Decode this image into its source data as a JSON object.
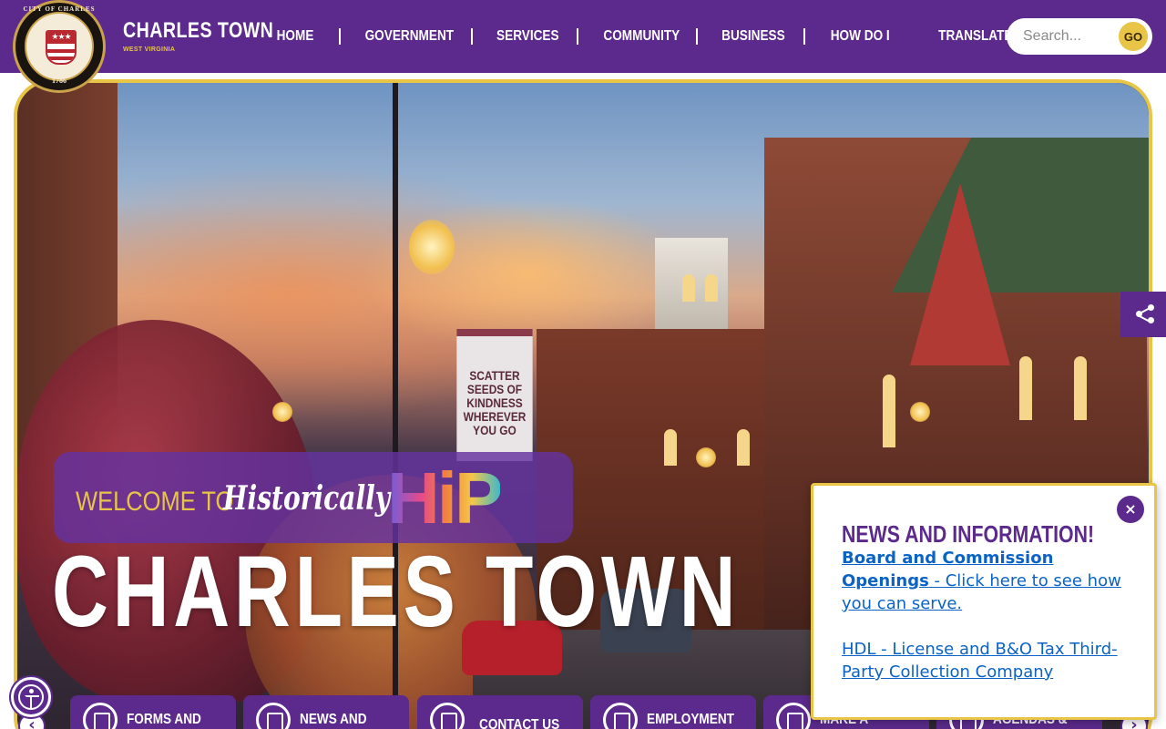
{
  "brand": {
    "title": "CHARLES TOWN",
    "subtitle": "WEST VIRGINIA",
    "seal_ring_text": "CITY OF CHARLES TOWN",
    "seal_year": "1786",
    "seal_stars": "★★★"
  },
  "nav": {
    "items": [
      "HOME",
      "GOVERNMENT",
      "SERVICES",
      "COMMUNITY",
      "BUSINESS",
      "HOW DO I",
      "TRANSLATE"
    ]
  },
  "search": {
    "placeholder": "Search...",
    "go_label": "GO"
  },
  "hero": {
    "welcome_to": "WELCOME TO",
    "welcome_script": "Historically",
    "welcome_hip": "HiP",
    "title": "CHARLES TOWN",
    "banner_text": "SCATTER SEEDS OF KINDNESS WHEREVER YOU GO"
  },
  "quick_links": [
    {
      "label": "FORMS AND"
    },
    {
      "label": "NEWS AND"
    },
    {
      "label": "CONTACT US"
    },
    {
      "label": "EMPLOYMENT"
    },
    {
      "label": "MAKE A"
    },
    {
      "label": "AGENDAS &"
    }
  ],
  "popup": {
    "heading": "NEWS AND INFORMATION!",
    "link1_bold": "Board and Commission Openings",
    "link1_rest": " - Click here to see how you can serve. ",
    "link2": "HDL - License and B&O Tax Third-Party Collection Company",
    "close_glyph": "×"
  },
  "colors": {
    "brand_purple": "#5b2a8c",
    "accent_gold": "#e8c547",
    "link_blue": "#0b63c5"
  }
}
